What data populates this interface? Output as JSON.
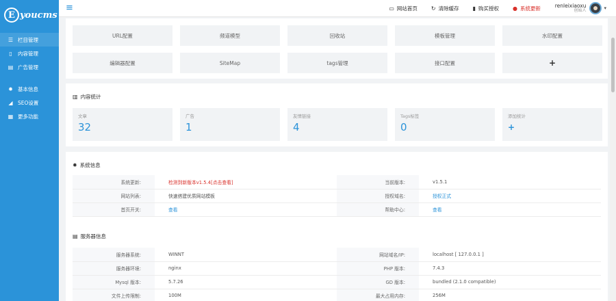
{
  "sidebar": {
    "logo_letter": "E",
    "logo_text": "youcms",
    "group1": [
      {
        "label": "栏目管理",
        "icon": "list-icon"
      },
      {
        "label": "内容管理",
        "icon": "file-icon"
      },
      {
        "label": "广告管理",
        "icon": "ad-icon"
      }
    ],
    "group2": [
      {
        "label": "基本信息",
        "icon": "gear-icon"
      },
      {
        "label": "SEO设置",
        "icon": "send-icon"
      },
      {
        "label": "更多功能",
        "icon": "grid-icon"
      }
    ]
  },
  "header": {
    "links": [
      {
        "label": "网站首页",
        "icon": "monitor-icon"
      },
      {
        "label": "清除缓存",
        "icon": "refresh-icon"
      },
      {
        "label": "购买授权",
        "icon": "bookmark-icon"
      },
      {
        "label": "系统更新",
        "icon": "alert-icon"
      }
    ],
    "user_name": "renleixiaoxu",
    "user_role": "创始人"
  },
  "quick_links": [
    "URL配置",
    "频道模型",
    "回收站",
    "模板管理",
    "水印配置",
    "编辑器配置",
    "SiteMap",
    "tags管理",
    "接口配置",
    "+"
  ],
  "content_stats": {
    "title": "内容统计",
    "items": [
      {
        "label": "文章",
        "value": "32"
      },
      {
        "label": "广告",
        "value": "1"
      },
      {
        "label": "友情链接",
        "value": "4"
      },
      {
        "label": "Tags标签",
        "value": "0"
      },
      {
        "label": "添加统计",
        "value": "+"
      }
    ]
  },
  "system_info": {
    "title": "系统信息",
    "rows": [
      [
        {
          "label": "系统更新:",
          "value": "检测到新版本v1.5.4[点击查看]"
        },
        {
          "label": "当前版本:",
          "value": "v1.5.1"
        }
      ],
      [
        {
          "label": "网站列表:",
          "value": "快速搭建优质网站模板"
        },
        {
          "label": "授权域名:",
          "value": "授权正式"
        }
      ],
      [
        {
          "label": "首页开关:",
          "value": "查看"
        },
        {
          "label": "帮助中心:",
          "value": "查看"
        }
      ]
    ]
  },
  "server_info": {
    "title": "服务器信息",
    "rows": [
      [
        {
          "label": "服务器系统:",
          "value": "WINNT"
        },
        {
          "label": "网站域名/IP:",
          "value": "localhost [ 127.0.0.1 ]"
        }
      ],
      [
        {
          "label": "服务器环境:",
          "value": "nginx"
        },
        {
          "label": "PHP 版本:",
          "value": "7.4.3"
        }
      ],
      [
        {
          "label": "Mysql 版本:",
          "value": "5.7.26"
        },
        {
          "label": "GD 版本:",
          "value": "bundled (2.1.0 compatible)"
        }
      ],
      [
        {
          "label": "文件上传限制:",
          "value": "100M"
        },
        {
          "label": "最大占用内存:",
          "value": "256M"
        }
      ]
    ]
  }
}
